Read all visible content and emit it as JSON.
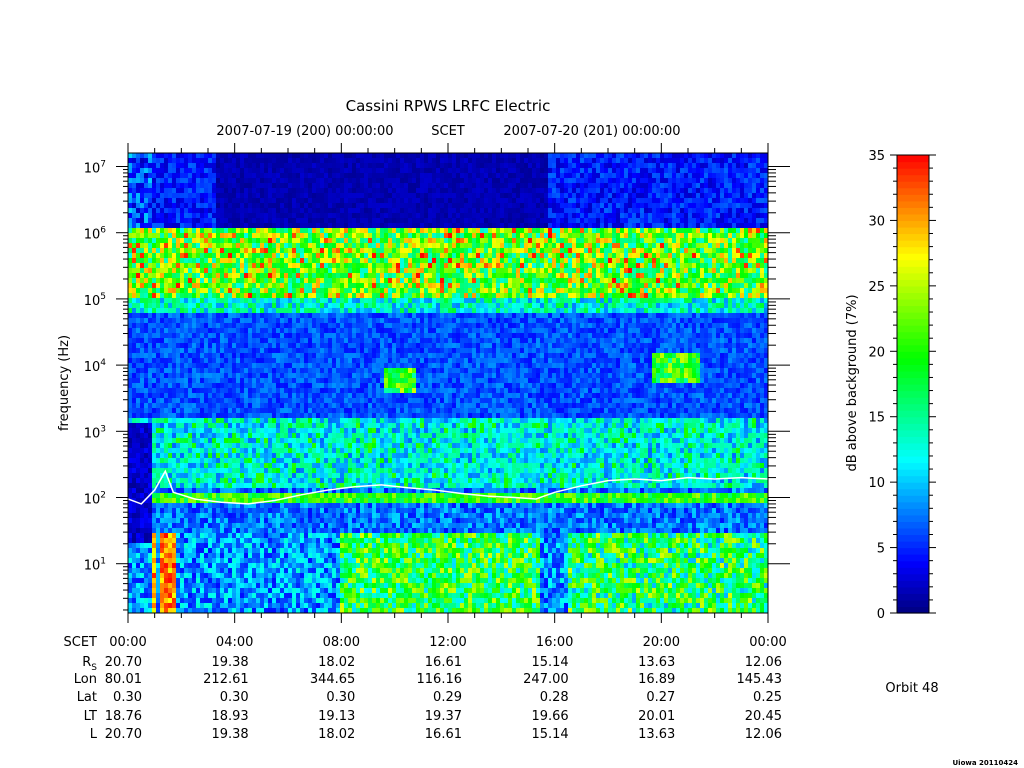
{
  "chart_data": {
    "type": "heatmap",
    "title": "Cassini RPWS LRFC Electric",
    "subtitle": {
      "start": "2007-07-19 (200) 00:00:00",
      "scet": "SCET",
      "end": "2007-07-20 (201) 00:00:00"
    },
    "ylabel": "frequency (Hz)",
    "y_scale": "log",
    "ylim": [
      1.8,
      16000000
    ],
    "y_ticks": [
      {
        "value": 10,
        "base": "10",
        "exp": "1"
      },
      {
        "value": 100,
        "base": "10",
        "exp": "2"
      },
      {
        "value": 1000,
        "base": "10",
        "exp": "3"
      },
      {
        "value": 10000,
        "base": "10",
        "exp": "4"
      },
      {
        "value": 100000,
        "base": "10",
        "exp": "5"
      },
      {
        "value": 1000000,
        "base": "10",
        "exp": "6"
      },
      {
        "value": 10000000,
        "base": "10",
        "exp": "7"
      }
    ],
    "x_hours": [
      0,
      4,
      8,
      12,
      16,
      20,
      24
    ],
    "x_tick_labels": [
      "00:00",
      "04:00",
      "08:00",
      "12:00",
      "16:00",
      "20:00",
      "00:00"
    ],
    "colorbar": {
      "label": "dB above background (7%)",
      "range": [
        0,
        35
      ],
      "ticks": [
        "0",
        "5",
        "10",
        "15",
        "20",
        "25",
        "30",
        "35"
      ],
      "colors": [
        "#00007f",
        "#0000ff",
        "#0080ff",
        "#00ffff",
        "#00ff80",
        "#00ff00",
        "#80ff00",
        "#ffff00",
        "#ff8000",
        "#ff0000"
      ]
    },
    "white_trace_hz": [
      {
        "h": 0.0,
        "f": 95
      },
      {
        "h": 0.5,
        "f": 80
      },
      {
        "h": 1.0,
        "f": 130
      },
      {
        "h": 1.4,
        "f": 250
      },
      {
        "h": 1.7,
        "f": 120
      },
      {
        "h": 2.5,
        "f": 95
      },
      {
        "h": 3.5,
        "f": 85
      },
      {
        "h": 4.5,
        "f": 80
      },
      {
        "h": 5.5,
        "f": 90
      },
      {
        "h": 6.5,
        "f": 110
      },
      {
        "h": 7.5,
        "f": 130
      },
      {
        "h": 8.5,
        "f": 145
      },
      {
        "h": 9.5,
        "f": 155
      },
      {
        "h": 10.5,
        "f": 140
      },
      {
        "h": 11.5,
        "f": 130
      },
      {
        "h": 12.5,
        "f": 115
      },
      {
        "h": 13.5,
        "f": 105
      },
      {
        "h": 14.5,
        "f": 100
      },
      {
        "h": 15.3,
        "f": 95
      },
      {
        "h": 16.0,
        "f": 120
      },
      {
        "h": 17.0,
        "f": 150
      },
      {
        "h": 18.0,
        "f": 180
      },
      {
        "h": 19.0,
        "f": 190
      },
      {
        "h": 20.0,
        "f": 180
      },
      {
        "h": 21.0,
        "f": 200
      },
      {
        "h": 22.0,
        "f": 190
      },
      {
        "h": 23.0,
        "f": 200
      },
      {
        "h": 24.0,
        "f": 190
      }
    ]
  },
  "ephemeris": {
    "rows": [
      {
        "label": "SCET",
        "sub": "",
        "values": [
          "00:00",
          "04:00",
          "08:00",
          "12:00",
          "16:00",
          "20:00",
          "00:00"
        ]
      },
      {
        "label": "R",
        "sub": "S",
        "values": [
          "20.70",
          "19.38",
          "18.02",
          "16.61",
          "15.14",
          "13.63",
          "12.06"
        ]
      },
      {
        "label": "Lon",
        "sub": "",
        "values": [
          "80.01",
          "212.61",
          "344.65",
          "116.16",
          "247.00",
          "16.89",
          "145.43"
        ]
      },
      {
        "label": "Lat",
        "sub": "",
        "values": [
          "0.30",
          "0.30",
          "0.30",
          "0.29",
          "0.28",
          "0.27",
          "0.25"
        ]
      },
      {
        "label": "LT",
        "sub": "",
        "values": [
          "18.76",
          "18.93",
          "19.13",
          "19.37",
          "19.66",
          "20.01",
          "20.45"
        ]
      },
      {
        "label": "L",
        "sub": "",
        "values": [
          "20.70",
          "19.38",
          "18.02",
          "16.61",
          "15.14",
          "13.63",
          "12.06"
        ]
      }
    ]
  },
  "orbit_label": "Orbit 48",
  "footer_stamp": "Uiowa 20110424"
}
